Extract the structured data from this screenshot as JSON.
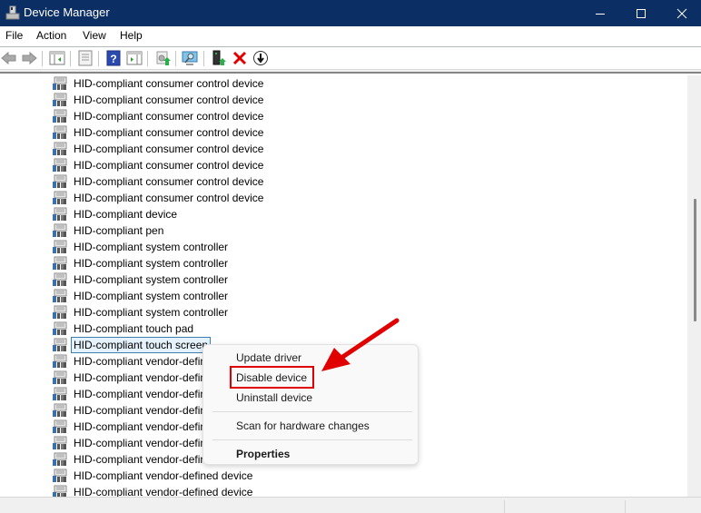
{
  "window": {
    "title": "Device Manager",
    "controls": {
      "minimize": "minimize",
      "maximize": "maximize",
      "close": "close"
    }
  },
  "menubar": {
    "items": [
      "File",
      "Action",
      "View",
      "Help"
    ]
  },
  "toolbar": {
    "buttons": [
      {
        "name": "back-icon"
      },
      {
        "name": "forward-icon"
      },
      {
        "name": "show-hide-console-tree-icon"
      },
      {
        "name": "properties-icon"
      },
      {
        "name": "help-icon"
      },
      {
        "name": "show-hide-action-pane-icon"
      },
      {
        "name": "update-driver-icon"
      },
      {
        "name": "scan-hardware-icon"
      },
      {
        "name": "add-legacy-hardware-icon"
      },
      {
        "name": "uninstall-icon"
      },
      {
        "name": "disable-icon"
      }
    ]
  },
  "tree": {
    "items": [
      "HID-compliant consumer control device",
      "HID-compliant consumer control device",
      "HID-compliant consumer control device",
      "HID-compliant consumer control device",
      "HID-compliant consumer control device",
      "HID-compliant consumer control device",
      "HID-compliant consumer control device",
      "HID-compliant consumer control device",
      "HID-compliant device",
      "HID-compliant pen",
      "HID-compliant system controller",
      "HID-compliant system controller",
      "HID-compliant system controller",
      "HID-compliant system controller",
      "HID-compliant system controller",
      "HID-compliant touch pad",
      "HID-compliant touch screen",
      "HID-compliant vendor-defined device",
      "HID-compliant vendor-defined device",
      "HID-compliant vendor-defined device",
      "HID-compliant vendor-defined device",
      "HID-compliant vendor-defined device",
      "HID-compliant vendor-defined device",
      "HID-compliant vendor-defined device",
      "HID-compliant vendor-defined device",
      "HID-compliant vendor-defined device"
    ],
    "selected_index": 16
  },
  "context_menu": {
    "items": [
      {
        "label": "Update driver",
        "bold": false
      },
      {
        "label": "Disable device",
        "bold": false,
        "highlighted": true
      },
      {
        "label": "Uninstall device",
        "bold": false
      },
      {
        "label": "Scan for hardware changes",
        "bold": false
      },
      {
        "label": "Properties",
        "bold": true
      }
    ]
  },
  "annotation": {
    "highlight_color": "#e00000",
    "target": "Disable device"
  },
  "colors": {
    "titlebar": "#0b2e64",
    "selection_border": "#3c7fb1",
    "annotation_red": "#e00000"
  }
}
